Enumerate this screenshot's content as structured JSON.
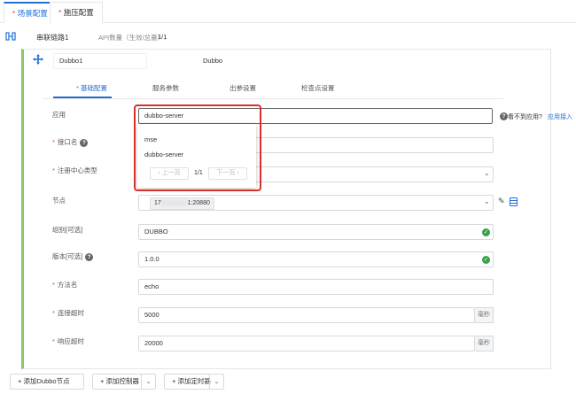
{
  "tabs": [
    {
      "label": "场景配置",
      "required": "*",
      "active": true
    },
    {
      "label": "施压配置",
      "required": "*",
      "active": false
    }
  ],
  "link": {
    "name": "串联链路1",
    "api_count_label": "API数量（生效/总量）:",
    "api_count_value": "1/1"
  },
  "node": {
    "name_value": "Dubbo1",
    "type": "Dubbo"
  },
  "subtabs": [
    "基础配置",
    "服务参数",
    "出参设置",
    "检查点设置"
  ],
  "subtab_required": "*",
  "form": {
    "app": {
      "label": "应用",
      "value": "dubbo-server",
      "not_found": "看不到应用?",
      "link": "应用接入"
    },
    "interface": {
      "label": "接口名",
      "required": "*"
    },
    "registry": {
      "label": "注册中心类型",
      "required": "*"
    },
    "node_field": {
      "label": "节点",
      "value_prefix": "17",
      "value_suffix": "1:20880"
    },
    "group": {
      "label": "组别[可选]",
      "value": "DUBBO"
    },
    "version": {
      "label": "版本[可选]",
      "value": "1.0.0"
    },
    "method": {
      "label": "方法名",
      "required": "*",
      "value": "echo"
    },
    "conn_timeout": {
      "label": "连接超时",
      "required": "*",
      "value": "5000",
      "unit": "毫秒"
    },
    "resp_timeout": {
      "label": "响应超时",
      "required": "*",
      "value": "20000",
      "unit": "毫秒"
    }
  },
  "dropdown": {
    "options": [
      "mse",
      "dubbo-server"
    ],
    "prev": "上一页",
    "page": "1/1",
    "next": "下一页"
  },
  "bottom": {
    "add_dubbo": "添加Dubbo节点",
    "add_controller": "添加控制器",
    "add_timer": "添加定时器",
    "plus": "+"
  },
  "colors": {
    "accent": "#1f70d8",
    "highlight": "#d9302b",
    "success": "#3aa14a",
    "card_edge": "#8cc56a"
  }
}
